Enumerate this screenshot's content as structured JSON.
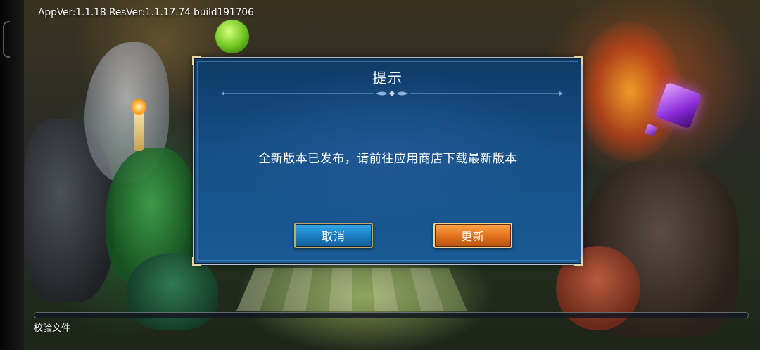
{
  "version_info": "AppVer:1.1.18 ResVer:1.1.17.74 build191706",
  "dialog": {
    "title": "提示",
    "message": "全新版本已发布，请前往应用商店下载最新版本",
    "cancel_label": "取消",
    "update_label": "更新"
  },
  "loading": {
    "status_text": "校验文件",
    "progress": 0
  },
  "colors": {
    "dialog_bg": "#154f86",
    "cancel_button": "#1c7fc4",
    "update_button": "#e3741e",
    "frame_gold": "#e3d7a8"
  }
}
